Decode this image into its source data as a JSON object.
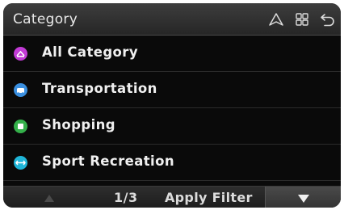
{
  "header": {
    "title": "Category",
    "icons": [
      "navigation-arrow-icon",
      "grid-menu-icon",
      "back-icon"
    ]
  },
  "categories": [
    {
      "label": "All Category",
      "icon": "all-category-icon",
      "color": "#c23bd6"
    },
    {
      "label": "Transportation",
      "icon": "car-icon",
      "color": "#3a8fe0"
    },
    {
      "label": "Shopping",
      "icon": "shopping-icon",
      "color": "#34b04a"
    },
    {
      "label": "Sport Recreation",
      "icon": "sport-icon",
      "color": "#1fb5d8"
    }
  ],
  "footer": {
    "page": "1/3",
    "apply_label": "Apply Filter"
  }
}
